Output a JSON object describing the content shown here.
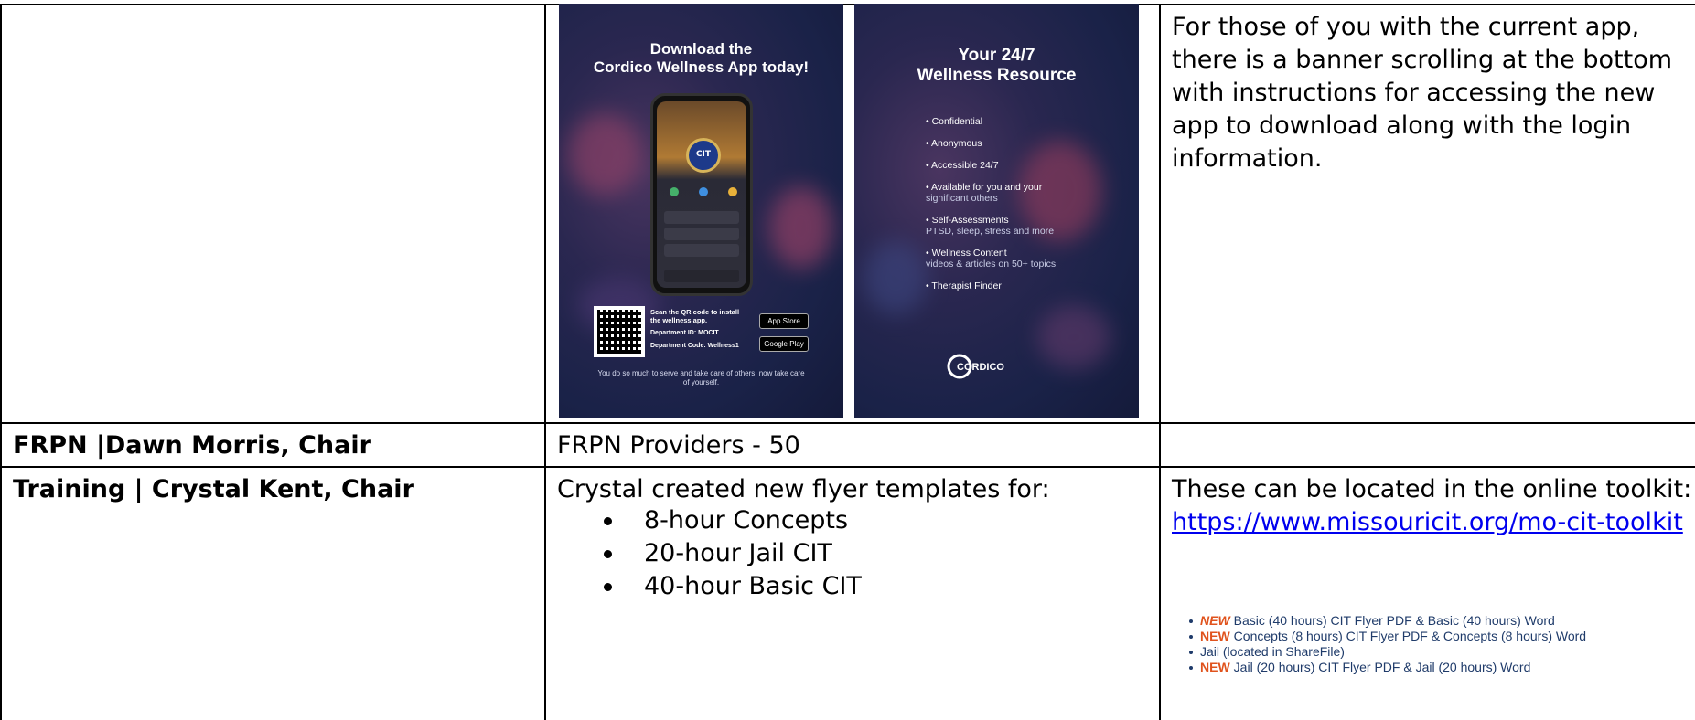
{
  "rows": [
    {
      "col1": "",
      "col2": "",
      "col3": "For those of you with the current app, there is a banner scrolling at the bottom with instructions for accessing the new app to download along with the login information."
    },
    {
      "col1": "FRPN |Dawn Morris, Chair",
      "col2": "FRPN Providers - 50",
      "col3": ""
    },
    {
      "col1": "Training | Crystal Kent, Chair",
      "col2_intro": "Crystal created new flyer templates for:",
      "col2_items": [
        "8-hour Concepts",
        "20-hour Jail CIT",
        "40-hour Basic CIT"
      ],
      "col3_intro": "These can be located in the online toolkit:",
      "col3_link": "https://www.missouricit.org/mo-cit-toolkit"
    }
  ],
  "flyer_left": {
    "title_line1": "Download the",
    "title_line2": "Cordico Wellness App today!",
    "seal_text": "CIT",
    "scan_text": "Scan the QR code to install the wellness app.",
    "department_id": "Department ID:  MOCIT",
    "department_code": "Department Code:  Wellness1",
    "app_store": "App Store",
    "google_play": "Google Play",
    "tagline": "You do so much to serve and take care of others, now take care of yourself."
  },
  "flyer_right": {
    "title_line1": "Your 24/7",
    "title_line2": "Wellness Resource",
    "features": [
      {
        "main": "Confidential",
        "sub": ""
      },
      {
        "main": "Anonymous",
        "sub": ""
      },
      {
        "main": "Accessible 24/7",
        "sub": ""
      },
      {
        "main": "Available for you and your",
        "sub": "significant others"
      },
      {
        "main": "Self-Assessments",
        "sub": "PTSD, sleep, stress and more"
      },
      {
        "main": "Wellness Content",
        "sub": "videos & articles on 50+ topics"
      },
      {
        "main": "Therapist Finder",
        "sub": ""
      }
    ],
    "logo_text": "CORDICO"
  },
  "toolkit_items": [
    {
      "badge": "NEW",
      "badge_style": "italic",
      "text": "Basic (40 hours) CIT Flyer PDF & Basic (40 hours) Word"
    },
    {
      "badge": "NEW",
      "badge_style": "plain",
      "text": "Concepts (8 hours) CIT Flyer PDF & Concepts (8 hours) Word"
    },
    {
      "badge": "",
      "badge_style": "",
      "text": "Jail (located in ShareFile)"
    },
    {
      "badge": "NEW",
      "badge_style": "plain",
      "text": "Jail (20 hours) CIT Flyer PDF & Jail (20 hours) Word"
    }
  ],
  "colors": {
    "link": "#0000ee",
    "new_badge": "#e0531d",
    "toolkit_text": "#1f3b6a",
    "flyer_bg": "#1a2248"
  }
}
